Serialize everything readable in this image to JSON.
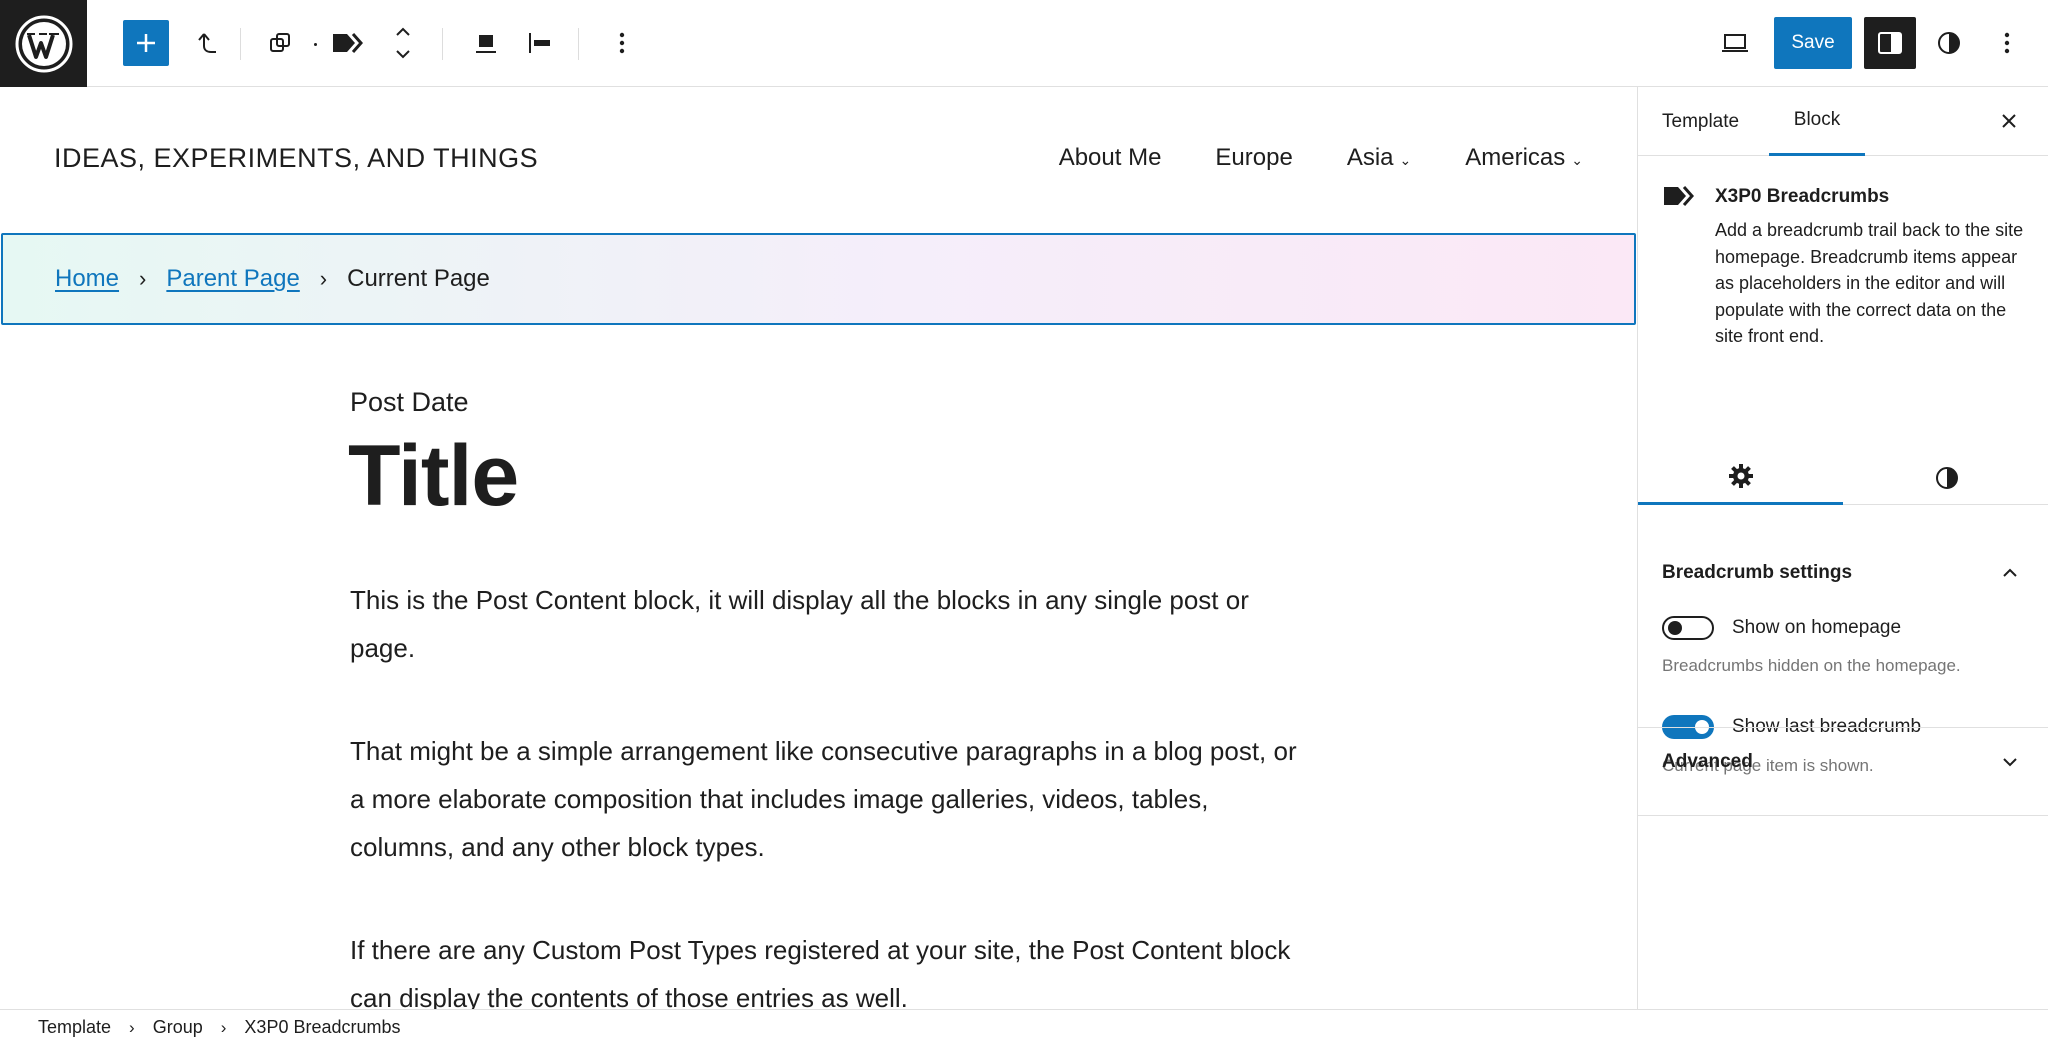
{
  "toolbar": {
    "save_label": "Save"
  },
  "site": {
    "title": "IDEAS, EXPERIMENTS, AND THINGS",
    "nav": [
      {
        "label": "About Me",
        "has_submenu": false
      },
      {
        "label": "Europe",
        "has_submenu": false
      },
      {
        "label": "Asia",
        "has_submenu": true
      },
      {
        "label": "Americas",
        "has_submenu": true
      }
    ],
    "caret": "⌄"
  },
  "breadcrumb_block": {
    "items": [
      "Home",
      "Parent Page",
      "Current Page"
    ],
    "separator": "›"
  },
  "post": {
    "date": "Post Date",
    "title": "Title",
    "paragraphs": [
      "This is the Post Content block, it will display all the blocks in any single post or page.",
      "That might be a simple arrangement like consecutive paragraphs in a blog post, or a more elaborate composition that includes image galleries, videos, tables, columns, and any other block types.",
      "If there are any Custom Post Types registered at your site, the Post Content block can display the contents of those entries as well."
    ]
  },
  "sidebar": {
    "tabs": [
      "Template",
      "Block"
    ],
    "active_tab": "Block",
    "block": {
      "name": "X3P0 Breadcrumbs",
      "description": "Add a breadcrumb trail back to the site homepage. Breadcrumb items appear as placeholders in the editor and will populate with the correct data on the site front end."
    },
    "settings_panel": {
      "title": "Breadcrumb settings",
      "toggles": [
        {
          "label": "Show on homepage",
          "checked": false,
          "help": "Breadcrumbs hidden on the homepage."
        },
        {
          "label": "Show last breadcrumb",
          "checked": true,
          "help": "Current page item is shown."
        }
      ]
    },
    "advanced_panel": {
      "title": "Advanced"
    }
  },
  "footer_breadcrumb": {
    "items": [
      "Template",
      "Group",
      "X3P0 Breadcrumbs"
    ],
    "separator": "›"
  },
  "colors": {
    "accent": "#0f76bd",
    "dark": "#1e1e1e",
    "muted": "#757575"
  }
}
